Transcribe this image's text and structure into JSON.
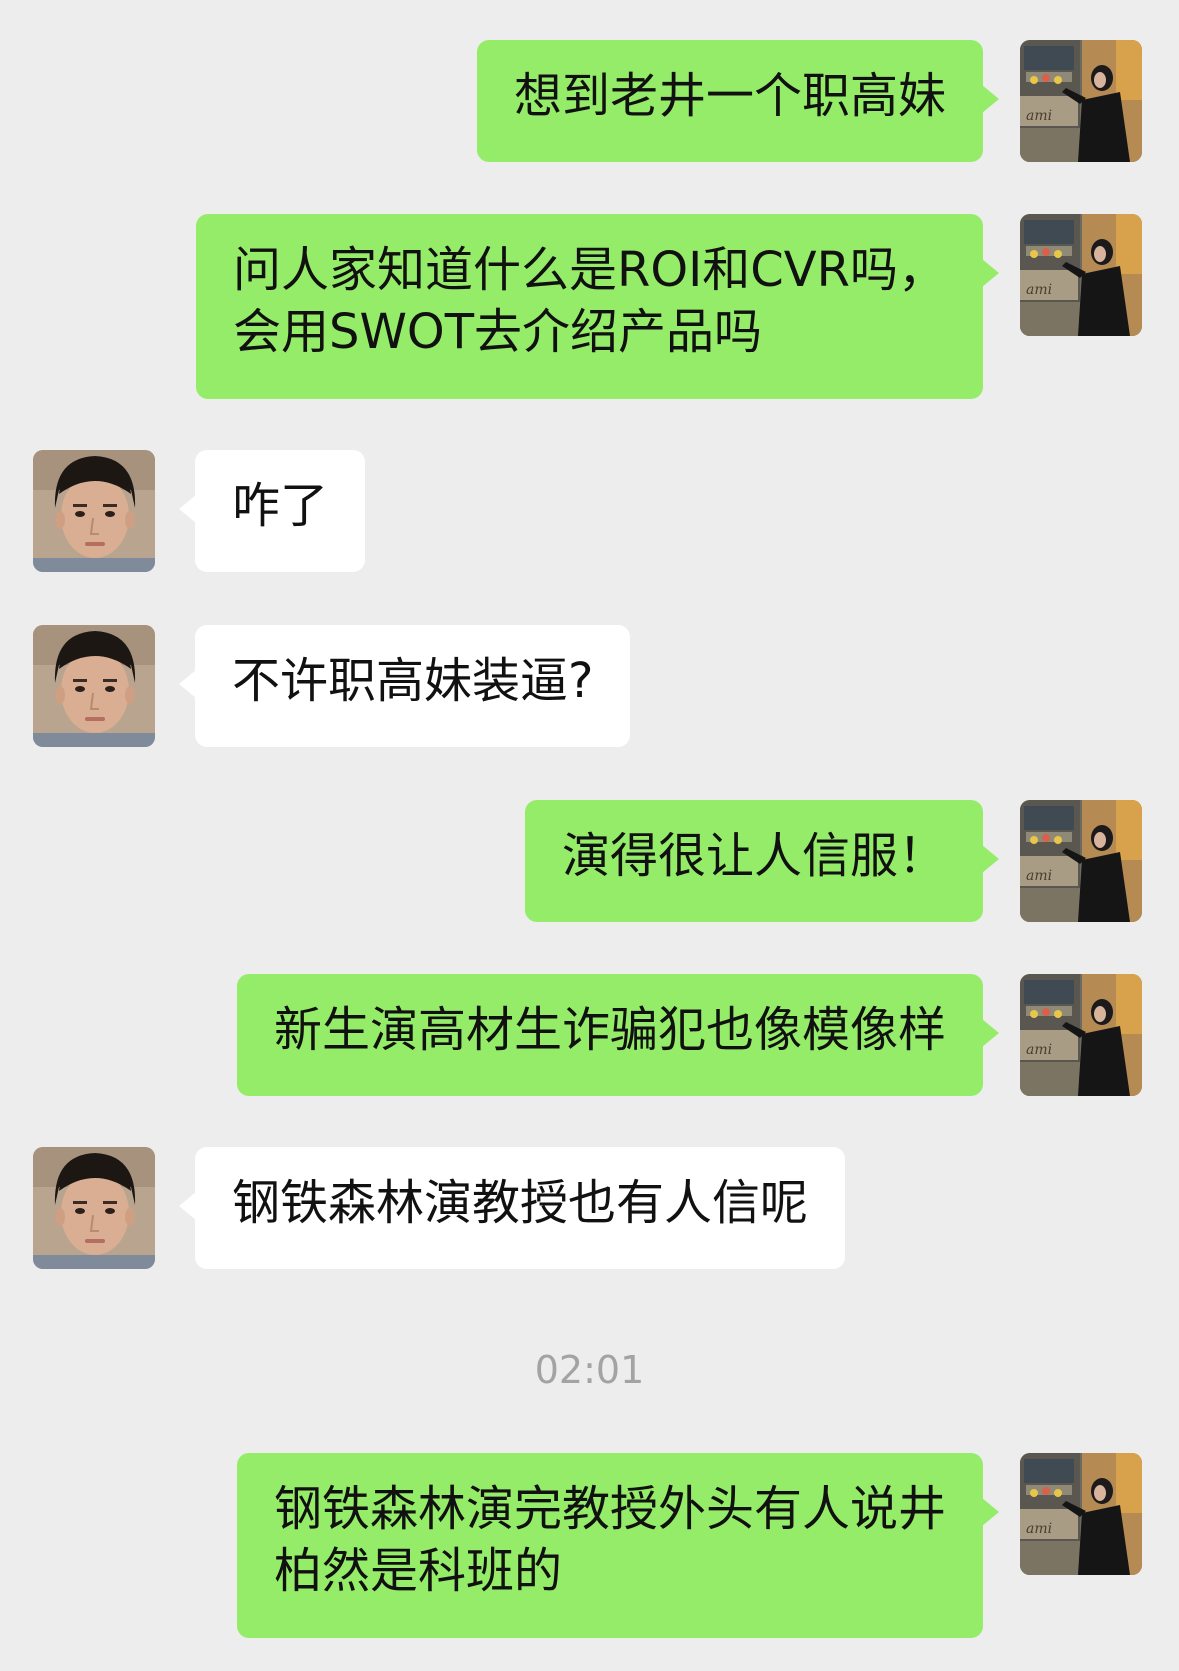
{
  "chat": {
    "messages": [
      {
        "side": "right",
        "text": "想到老井一个职高妹"
      },
      {
        "side": "right",
        "text": "问人家知道什么是ROI和CVR吗，\n会用SWOT去介绍产品吗"
      },
      {
        "side": "left",
        "text": "咋了"
      },
      {
        "side": "left",
        "text": "不许职高妹装逼?"
      },
      {
        "side": "right",
        "text": "演得很让人信服！"
      },
      {
        "side": "right",
        "text": "新生演高材生诈骗犯也像模像样"
      },
      {
        "side": "left",
        "text": "钢铁森林演教授也有人信呢"
      },
      {
        "side": "right",
        "text": "钢铁森林演完教授外头有人说井\n柏然是科班的"
      }
    ],
    "timestamp": "02:01"
  },
  "colors": {
    "background": "#ededed",
    "my_bubble": "#95ec69",
    "their_bubble": "#ffffff",
    "timestamp_text": "#a3a3a3"
  },
  "icons": {
    "my_avatar": "woman-in-black-coat-avatar",
    "their_avatar": "young-man-portrait-avatar"
  }
}
